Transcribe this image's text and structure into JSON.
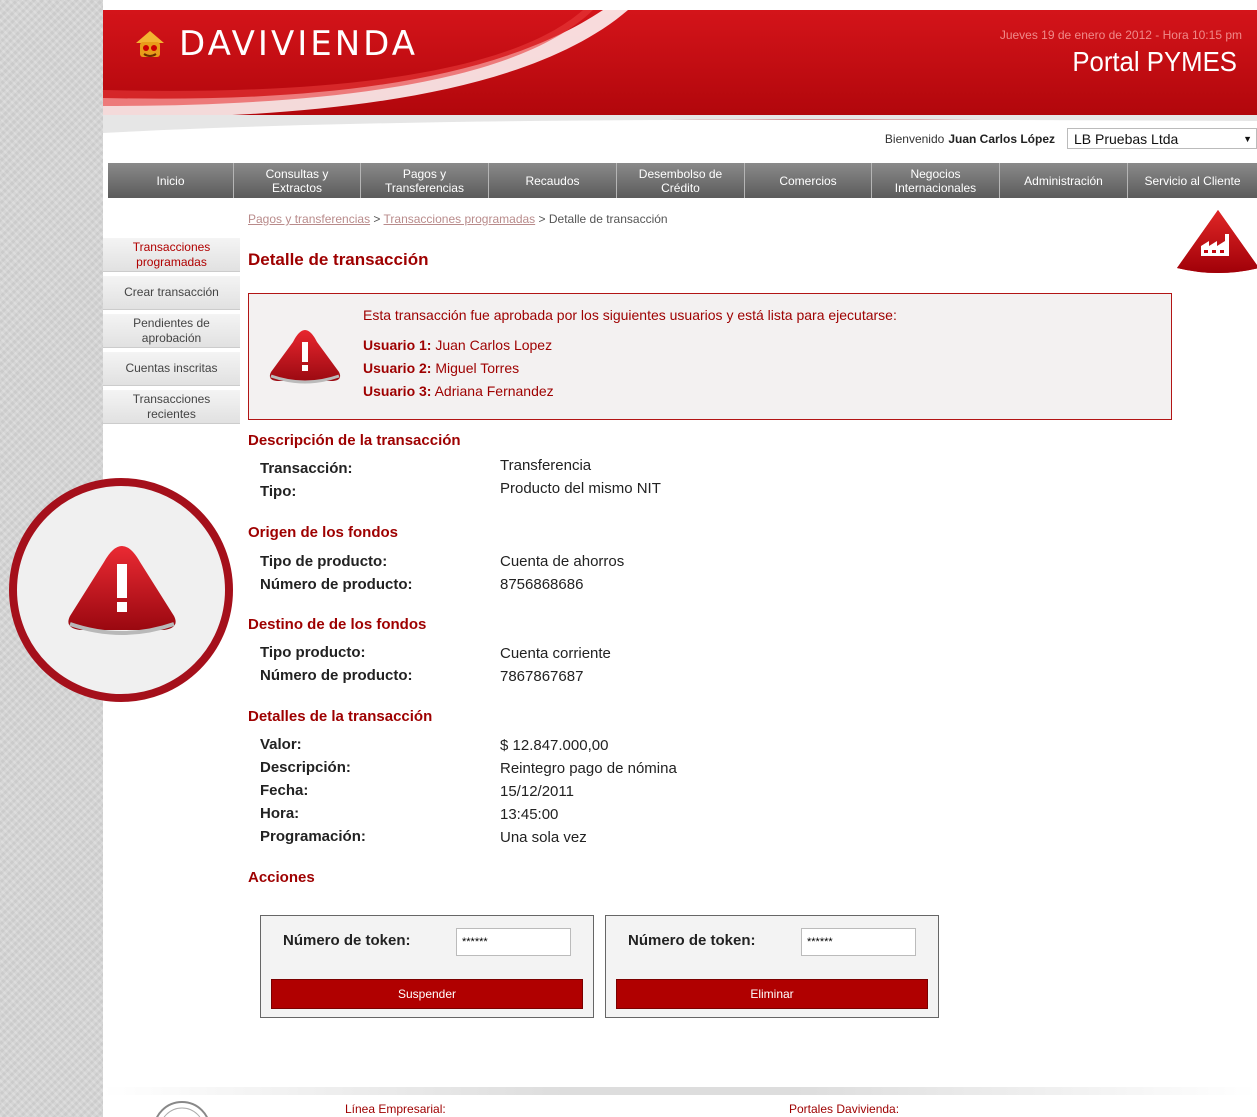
{
  "header": {
    "logo_text": "DAVIVIENDA",
    "datetime": "Jueves 19 de enero de 2012 - Hora 10:15 pm",
    "portal_title": "Portal PYMES"
  },
  "welcome": {
    "greeting": "Bienvenido",
    "user_name": "Juan Carlos López",
    "company": "LB Pruebas Ltda"
  },
  "nav": {
    "items": [
      {
        "label": "Inicio"
      },
      {
        "label": "Consultas  y\nExtractos"
      },
      {
        "label": "Pagos y\nTransferencias"
      },
      {
        "label": "Recaudos"
      },
      {
        "label": "Desembolso de\nCrédito"
      },
      {
        "label": "Comercios"
      },
      {
        "label": "Negocios\nInternacionales"
      },
      {
        "label": "Administración"
      },
      {
        "label": "Servicio al Cliente"
      }
    ]
  },
  "breadcrumb": {
    "link1": "Pagos y transferencias",
    "sep": " > ",
    "link2": "Transacciones programadas",
    "current": " > Detalle de transacción"
  },
  "sidebar": {
    "items": [
      {
        "label": "Transacciones\nprogramadas",
        "active": true
      },
      {
        "label": "Crear transacción"
      },
      {
        "label": "Pendientes de\naprobación"
      },
      {
        "label": "Cuentas inscritas"
      },
      {
        "label": "Transacciones\nrecientes"
      }
    ]
  },
  "page_title": "Detalle de transacción",
  "alert": {
    "message": "Esta transacción fue aprobada por los siguientes usuarios y está lista para ejecutarse:",
    "users": [
      {
        "label": "Usuario 1:",
        "name": "Juan Carlos Lopez"
      },
      {
        "label": "Usuario 2:",
        "name": "Miguel Torres"
      },
      {
        "label": "Usuario 3:",
        "name": "Adriana Fernandez"
      }
    ]
  },
  "sections": {
    "descripcion": {
      "title": "Descripción de la transacción",
      "fields": [
        {
          "label": "Transacción:",
          "value": "Transferencia"
        },
        {
          "label": "Tipo:",
          "value": "Producto del mismo NIT"
        }
      ]
    },
    "origen": {
      "title": "Origen de los fondos",
      "fields": [
        {
          "label": "Tipo de producto:",
          "value": "Cuenta de ahorros"
        },
        {
          "label": "Número de producto:",
          "value": "8756868686"
        }
      ]
    },
    "destino": {
      "title": "Destino de de los fondos",
      "fields": [
        {
          "label": "Tipo producto:",
          "value": "Cuenta corriente"
        },
        {
          "label": "Número de producto:",
          "value": "7867867687"
        }
      ]
    },
    "detalles": {
      "title": "Detalles de la transacción",
      "fields": [
        {
          "label": "Valor:",
          "value": "$ 12.847.000,00"
        },
        {
          "label": "Descripción:",
          "value": "Reintegro pago de nómina"
        },
        {
          "label": "Fecha:",
          "value": "15/12/2011"
        },
        {
          "label": "Hora:",
          "value": "13:45:00"
        },
        {
          "label": "Programación:",
          "value": "Una sola vez"
        }
      ]
    }
  },
  "actions": {
    "title": "Acciones",
    "suspend": {
      "token_label": "Número de token:",
      "token_value": "******",
      "button": "Suspender"
    },
    "delete": {
      "token_label": "Número de token:",
      "token_value": "******",
      "button": "Eliminar"
    }
  },
  "footer": {
    "left": "Línea Empresarial:",
    "right": "Portales Davivienda:"
  },
  "colors": {
    "brand_red": "#b00000",
    "accent_text": "#9e0000"
  }
}
